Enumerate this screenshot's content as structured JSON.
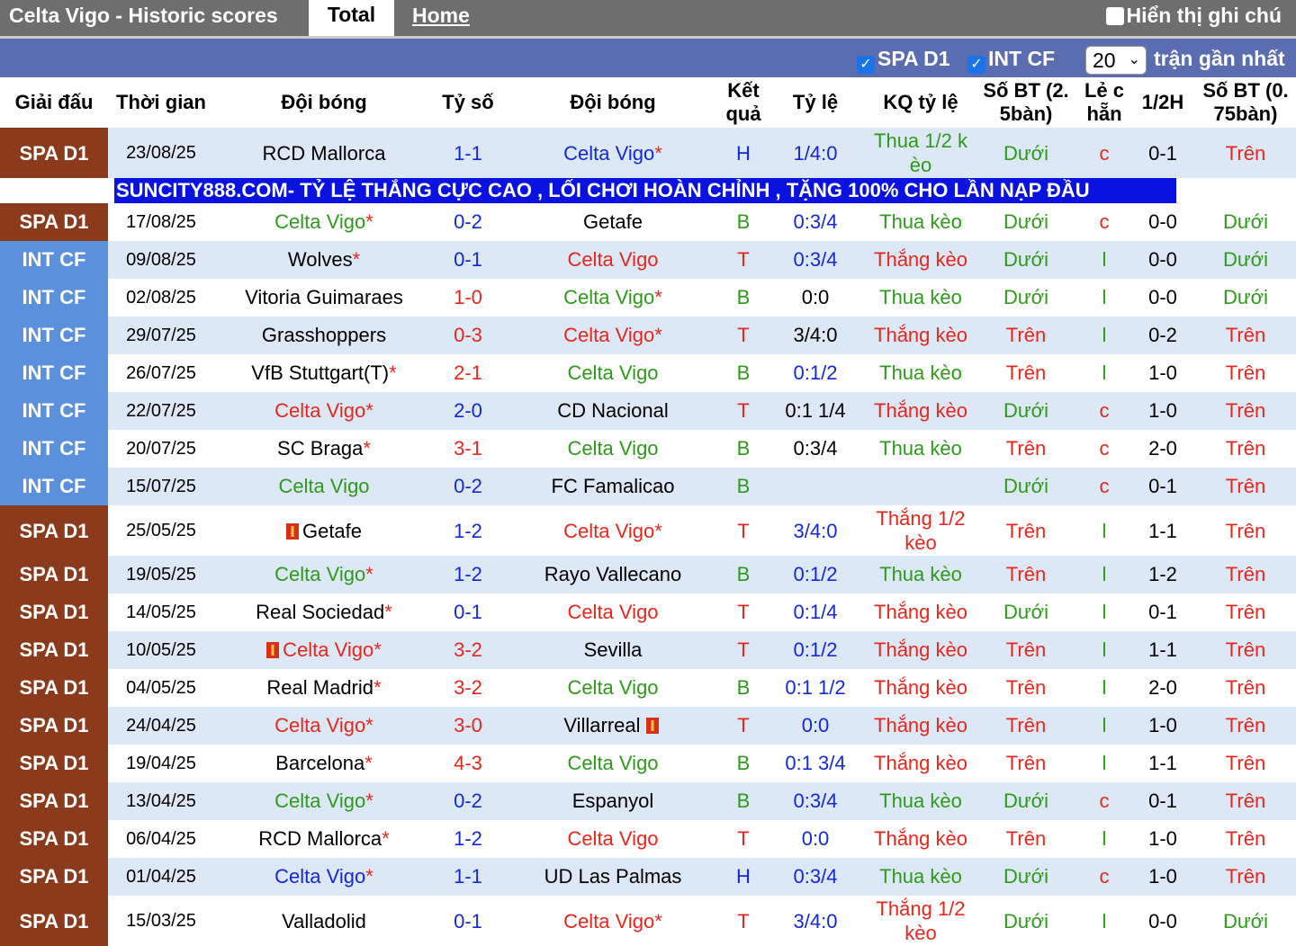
{
  "topbar": {
    "title": "Celta Vigo - Historic scores",
    "tab_total": "Total",
    "tab_home": "Home",
    "show_notes": "Hiển thị ghi chú"
  },
  "filters": {
    "spa": "SPA D1",
    "int": "INT CF",
    "count": "20",
    "recent_label": "trận gần nhất"
  },
  "headers": {
    "league": "Giải đấu",
    "time": "Thời gian",
    "home": "Đội bóng",
    "score": "Tỷ số",
    "away": "Đội bóng",
    "result": "Kết quả",
    "odds": "Tỷ lệ",
    "odds_result": "KQ tỷ lệ",
    "goals25": "Số BT (2. 5bàn)",
    "oddeven": "Lẻ c hẵn",
    "half": "1/2H",
    "goals075": "Số BT (0. 75bàn)"
  },
  "ad": "SUNCITY888.COM- TỶ LỆ THẮNG CỰC CAO , LỐI CHƠI HOÀN CHỈNH , TẶNG 100% CHO LẦN NẠP ĐẦU",
  "colors": {
    "spa": "#8c3a1c",
    "int": "#5a90dc",
    "red": "#e8261d",
    "green": "#2d9a1b",
    "blue": "#1428d8",
    "ad": "#0a12e0"
  },
  "rows": [
    {
      "league": "SPA D1",
      "lc": "spa",
      "date": "23/08/25",
      "home": "RCD Mallorca",
      "hc": "black",
      "hstar": "",
      "hflag": false,
      "score": "1-1",
      "sc": "blue",
      "away": "Celta Vigo",
      "ac": "blue",
      "astar": "*",
      "aflag": false,
      "res": "H",
      "rc": "blue",
      "odds": "1/4:0",
      "oc": "blue",
      "kq": "Thua 1/2 k èo",
      "kc": "green",
      "g25": "Dưới",
      "g25c": "green",
      "oe": "c",
      "oec": "red",
      "half": "0-1",
      "g075": "Trên",
      "g075c": "red",
      "tall": true
    },
    {
      "league": "SPA D1",
      "lc": "spa",
      "date": "17/08/25",
      "home": "Celta Vigo",
      "hc": "green",
      "hstar": "*",
      "hflag": false,
      "score": "0-2",
      "sc": "blue",
      "away": "Getafe",
      "ac": "black",
      "astar": "",
      "aflag": false,
      "res": "B",
      "rc": "green",
      "odds": "0:3/4",
      "oc": "blue",
      "kq": "Thua kèo",
      "kc": "green",
      "g25": "Dưới",
      "g25c": "green",
      "oe": "c",
      "oec": "red",
      "half": "0-0",
      "g075": "Dưới",
      "g075c": "green",
      "tall": false
    },
    {
      "league": "INT CF",
      "lc": "int",
      "date": "09/08/25",
      "home": "Wolves",
      "hc": "black",
      "hstar": "*",
      "hflag": false,
      "score": "0-1",
      "sc": "blue",
      "away": "Celta Vigo",
      "ac": "red",
      "astar": "",
      "aflag": false,
      "res": "T",
      "rc": "red",
      "odds": "0:3/4",
      "oc": "blue",
      "kq": "Thắng kèo",
      "kc": "red",
      "g25": "Dưới",
      "g25c": "green",
      "oe": "l",
      "oec": "green",
      "half": "0-0",
      "g075": "Dưới",
      "g075c": "green",
      "tall": false
    },
    {
      "league": "INT CF",
      "lc": "int",
      "date": "02/08/25",
      "home": "Vitoria Guimaraes",
      "hc": "black",
      "hstar": "",
      "hflag": false,
      "score": "1-0",
      "sc": "red",
      "away": "Celta Vigo",
      "ac": "green",
      "astar": "*",
      "aflag": false,
      "res": "B",
      "rc": "green",
      "odds": "0:0",
      "oc": "black",
      "kq": "Thua kèo",
      "kc": "green",
      "g25": "Dưới",
      "g25c": "green",
      "oe": "l",
      "oec": "green",
      "half": "0-0",
      "g075": "Dưới",
      "g075c": "green",
      "tall": false
    },
    {
      "league": "INT CF",
      "lc": "int",
      "date": "29/07/25",
      "home": "Grasshoppers",
      "hc": "black",
      "hstar": "",
      "hflag": false,
      "score": "0-3",
      "sc": "red",
      "away": "Celta Vigo",
      "ac": "red",
      "astar": "*",
      "aflag": false,
      "res": "T",
      "rc": "red",
      "odds": "3/4:0",
      "oc": "black",
      "kq": "Thắng kèo",
      "kc": "red",
      "g25": "Trên",
      "g25c": "red",
      "oe": "l",
      "oec": "green",
      "half": "0-2",
      "g075": "Trên",
      "g075c": "red",
      "tall": false
    },
    {
      "league": "INT CF",
      "lc": "int",
      "date": "26/07/25",
      "home": "VfB Stuttgart(T)",
      "hc": "black",
      "hstar": "*",
      "hflag": false,
      "score": "2-1",
      "sc": "red",
      "away": "Celta Vigo",
      "ac": "green",
      "astar": "",
      "aflag": false,
      "res": "B",
      "rc": "green",
      "odds": "0:1/2",
      "oc": "blue",
      "kq": "Thua kèo",
      "kc": "green",
      "g25": "Trên",
      "g25c": "red",
      "oe": "l",
      "oec": "green",
      "half": "1-0",
      "g075": "Trên",
      "g075c": "red",
      "tall": false
    },
    {
      "league": "INT CF",
      "lc": "int",
      "date": "22/07/25",
      "home": "Celta Vigo",
      "hc": "red",
      "hstar": "*",
      "hflag": false,
      "score": "2-0",
      "sc": "blue",
      "away": "CD Nacional",
      "ac": "black",
      "astar": "",
      "aflag": false,
      "res": "T",
      "rc": "red",
      "odds": "0:1 1/4",
      "oc": "black",
      "kq": "Thắng kèo",
      "kc": "red",
      "g25": "Dưới",
      "g25c": "green",
      "oe": "c",
      "oec": "red",
      "half": "1-0",
      "g075": "Trên",
      "g075c": "red",
      "tall": false
    },
    {
      "league": "INT CF",
      "lc": "int",
      "date": "20/07/25",
      "home": "SC Braga",
      "hc": "black",
      "hstar": "*",
      "hflag": false,
      "score": "3-1",
      "sc": "red",
      "away": "Celta Vigo",
      "ac": "green",
      "astar": "",
      "aflag": false,
      "res": "B",
      "rc": "green",
      "odds": "0:3/4",
      "oc": "black",
      "kq": "Thua kèo",
      "kc": "green",
      "g25": "Trên",
      "g25c": "red",
      "oe": "c",
      "oec": "red",
      "half": "2-0",
      "g075": "Trên",
      "g075c": "red",
      "tall": false
    },
    {
      "league": "INT CF",
      "lc": "int",
      "date": "15/07/25",
      "home": "Celta Vigo",
      "hc": "green",
      "hstar": "",
      "hflag": false,
      "score": "0-2",
      "sc": "blue",
      "away": "FC Famalicao",
      "ac": "black",
      "astar": "",
      "aflag": false,
      "res": "B",
      "rc": "green",
      "odds": "",
      "oc": "black",
      "kq": "",
      "kc": "green",
      "g25": "Dưới",
      "g25c": "green",
      "oe": "c",
      "oec": "red",
      "half": "0-1",
      "g075": "Trên",
      "g075c": "red",
      "tall": false
    },
    {
      "league": "SPA D1",
      "lc": "spa",
      "date": "25/05/25",
      "home": "Getafe",
      "hc": "black",
      "hstar": "",
      "hflag": true,
      "score": "1-2",
      "sc": "blue",
      "away": "Celta Vigo",
      "ac": "red",
      "astar": "*",
      "aflag": false,
      "res": "T",
      "rc": "red",
      "odds": "3/4:0",
      "oc": "blue",
      "kq": "Thắng 1/2 kèo",
      "kc": "red",
      "g25": "Trên",
      "g25c": "red",
      "oe": "l",
      "oec": "green",
      "half": "1-1",
      "g075": "Trên",
      "g075c": "red",
      "tall": true
    },
    {
      "league": "SPA D1",
      "lc": "spa",
      "date": "19/05/25",
      "home": "Celta Vigo",
      "hc": "green",
      "hstar": "*",
      "hflag": false,
      "score": "1-2",
      "sc": "blue",
      "away": "Rayo Vallecano",
      "ac": "black",
      "astar": "",
      "aflag": false,
      "res": "B",
      "rc": "green",
      "odds": "0:1/2",
      "oc": "blue",
      "kq": "Thua kèo",
      "kc": "green",
      "g25": "Trên",
      "g25c": "red",
      "oe": "l",
      "oec": "green",
      "half": "1-2",
      "g075": "Trên",
      "g075c": "red",
      "tall": false
    },
    {
      "league": "SPA D1",
      "lc": "spa",
      "date": "14/05/25",
      "home": "Real Sociedad",
      "hc": "black",
      "hstar": "*",
      "hflag": false,
      "score": "0-1",
      "sc": "blue",
      "away": "Celta Vigo",
      "ac": "red",
      "astar": "",
      "aflag": false,
      "res": "T",
      "rc": "red",
      "odds": "0:1/4",
      "oc": "blue",
      "kq": "Thắng kèo",
      "kc": "red",
      "g25": "Dưới",
      "g25c": "green",
      "oe": "l",
      "oec": "green",
      "half": "0-1",
      "g075": "Trên",
      "g075c": "red",
      "tall": false
    },
    {
      "league": "SPA D1",
      "lc": "spa",
      "date": "10/05/25",
      "home": "Celta Vigo",
      "hc": "red",
      "hstar": "*",
      "hflag": true,
      "score": "3-2",
      "sc": "red",
      "away": "Sevilla",
      "ac": "black",
      "astar": "",
      "aflag": false,
      "res": "T",
      "rc": "red",
      "odds": "0:1/2",
      "oc": "blue",
      "kq": "Thắng kèo",
      "kc": "red",
      "g25": "Trên",
      "g25c": "red",
      "oe": "l",
      "oec": "green",
      "half": "1-1",
      "g075": "Trên",
      "g075c": "red",
      "tall": false
    },
    {
      "league": "SPA D1",
      "lc": "spa",
      "date": "04/05/25",
      "home": "Real Madrid",
      "hc": "black",
      "hstar": "*",
      "hflag": false,
      "score": "3-2",
      "sc": "red",
      "away": "Celta Vigo",
      "ac": "green",
      "astar": "",
      "aflag": false,
      "res": "B",
      "rc": "green",
      "odds": "0:1 1/2",
      "oc": "blue",
      "kq": "Thắng kèo",
      "kc": "red",
      "g25": "Trên",
      "g25c": "red",
      "oe": "l",
      "oec": "green",
      "half": "2-0",
      "g075": "Trên",
      "g075c": "red",
      "tall": false
    },
    {
      "league": "SPA D1",
      "lc": "spa",
      "date": "24/04/25",
      "home": "Celta Vigo",
      "hc": "red",
      "hstar": "*",
      "hflag": false,
      "score": "3-0",
      "sc": "red",
      "away": "Villarreal",
      "ac": "black",
      "astar": "",
      "aflag": true,
      "res": "T",
      "rc": "red",
      "odds": "0:0",
      "oc": "blue",
      "kq": "Thắng kèo",
      "kc": "red",
      "g25": "Trên",
      "g25c": "red",
      "oe": "l",
      "oec": "green",
      "half": "1-0",
      "g075": "Trên",
      "g075c": "red",
      "tall": false
    },
    {
      "league": "SPA D1",
      "lc": "spa",
      "date": "19/04/25",
      "home": "Barcelona",
      "hc": "black",
      "hstar": "*",
      "hflag": false,
      "score": "4-3",
      "sc": "red",
      "away": "Celta Vigo",
      "ac": "green",
      "astar": "",
      "aflag": false,
      "res": "B",
      "rc": "green",
      "odds": "0:1 3/4",
      "oc": "blue",
      "kq": "Thắng kèo",
      "kc": "red",
      "g25": "Trên",
      "g25c": "red",
      "oe": "l",
      "oec": "green",
      "half": "1-1",
      "g075": "Trên",
      "g075c": "red",
      "tall": false
    },
    {
      "league": "SPA D1",
      "lc": "spa",
      "date": "13/04/25",
      "home": "Celta Vigo",
      "hc": "green",
      "hstar": "*",
      "hflag": false,
      "score": "0-2",
      "sc": "blue",
      "away": "Espanyol",
      "ac": "black",
      "astar": "",
      "aflag": false,
      "res": "B",
      "rc": "green",
      "odds": "0:3/4",
      "oc": "blue",
      "kq": "Thua kèo",
      "kc": "green",
      "g25": "Dưới",
      "g25c": "green",
      "oe": "c",
      "oec": "red",
      "half": "0-1",
      "g075": "Trên",
      "g075c": "red",
      "tall": false
    },
    {
      "league": "SPA D1",
      "lc": "spa",
      "date": "06/04/25",
      "home": "RCD Mallorca",
      "hc": "black",
      "hstar": "*",
      "hflag": false,
      "score": "1-2",
      "sc": "blue",
      "away": "Celta Vigo",
      "ac": "red",
      "astar": "",
      "aflag": false,
      "res": "T",
      "rc": "red",
      "odds": "0:0",
      "oc": "blue",
      "kq": "Thắng kèo",
      "kc": "red",
      "g25": "Trên",
      "g25c": "red",
      "oe": "l",
      "oec": "green",
      "half": "1-0",
      "g075": "Trên",
      "g075c": "red",
      "tall": false
    },
    {
      "league": "SPA D1",
      "lc": "spa",
      "date": "01/04/25",
      "home": "Celta Vigo",
      "hc": "blue",
      "hstar": "*",
      "hflag": false,
      "score": "1-1",
      "sc": "blue",
      "away": "UD Las Palmas",
      "ac": "black",
      "astar": "",
      "aflag": false,
      "res": "H",
      "rc": "blue",
      "odds": "0:3/4",
      "oc": "blue",
      "kq": "Thua kèo",
      "kc": "green",
      "g25": "Dưới",
      "g25c": "green",
      "oe": "c",
      "oec": "red",
      "half": "1-0",
      "g075": "Trên",
      "g075c": "red",
      "tall": false
    },
    {
      "league": "SPA D1",
      "lc": "spa",
      "date": "15/03/25",
      "home": "Valladolid",
      "hc": "black",
      "hstar": "",
      "hflag": false,
      "score": "0-1",
      "sc": "blue",
      "away": "Celta Vigo",
      "ac": "red",
      "astar": "*",
      "aflag": false,
      "res": "T",
      "rc": "red",
      "odds": "3/4:0",
      "oc": "blue",
      "kq": "Thắng 1/2 kèo",
      "kc": "red",
      "g25": "Dưới",
      "g25c": "green",
      "oe": "l",
      "oec": "green",
      "half": "0-0",
      "g075": "Dưới",
      "g075c": "green",
      "tall": true
    }
  ]
}
